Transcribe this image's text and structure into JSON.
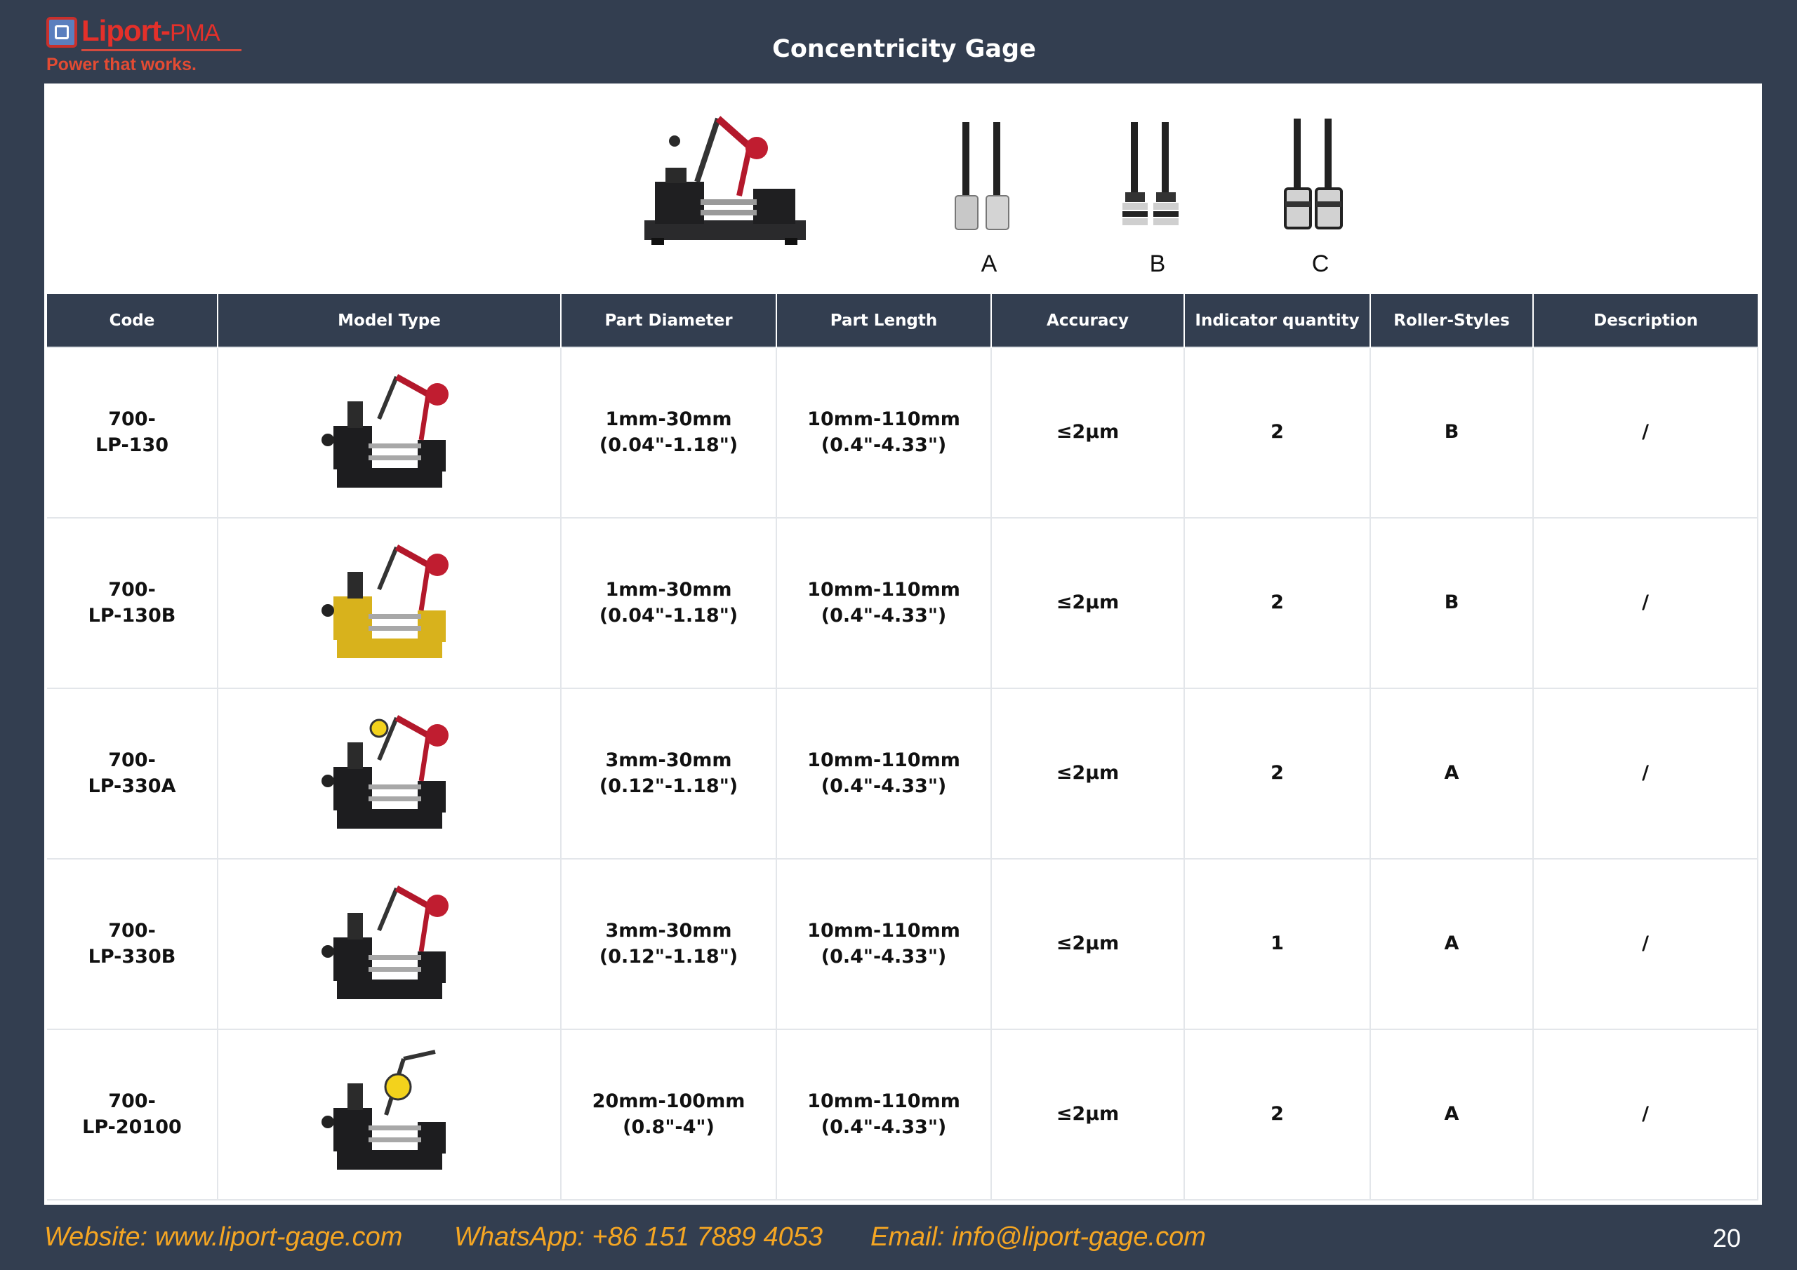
{
  "header": {
    "logo_name": "Liport-",
    "logo_suffix": "PMA",
    "logo_tagline": "Power that works.",
    "title": "Concentricity Gage"
  },
  "roller_styles": [
    "A",
    "B",
    "C"
  ],
  "table": {
    "columns": [
      "Code",
      "Model Type",
      "Part Diameter",
      "Part Length",
      "Accuracy",
      "Indicator quantity",
      "Roller-Styles",
      "Description"
    ],
    "rows": [
      {
        "code_line1": "700-",
        "code_line2": "LP-130",
        "gage_color": "#1d1d1f",
        "indicator": "red-arm",
        "diameter_line1": "1mm-30mm",
        "diameter_line2": "(0.04\"-1.18\")",
        "length_line1": "10mm-110mm",
        "length_line2": "(0.4\"-4.33\")",
        "accuracy": "≤2μm",
        "indicator_qty": "2",
        "roller": "B",
        "description": "/"
      },
      {
        "code_line1": "700-",
        "code_line2": "LP-130B",
        "gage_color": "#d8b21c",
        "indicator": "red-arm",
        "diameter_line1": "1mm-30mm",
        "diameter_line2": "(0.04\"-1.18\")",
        "length_line1": "10mm-110mm",
        "length_line2": "(0.4\"-4.33\")",
        "accuracy": "≤2μm",
        "indicator_qty": "2",
        "roller": "B",
        "description": "/"
      },
      {
        "code_line1": "700-",
        "code_line2": "LP-330A",
        "gage_color": "#1d1d1f",
        "indicator": "red-arm-dial",
        "diameter_line1": "3mm-30mm",
        "diameter_line2": "(0.12\"-1.18\")",
        "length_line1": "10mm-110mm",
        "length_line2": "(0.4\"-4.33\")",
        "accuracy": "≤2μm",
        "indicator_qty": "2",
        "roller": "A",
        "description": "/"
      },
      {
        "code_line1": "700-",
        "code_line2": "LP-330B",
        "gage_color": "#1d1d1f",
        "indicator": "red-arm",
        "diameter_line1": "3mm-30mm",
        "diameter_line2": "(0.12\"-1.18\")",
        "length_line1": "10mm-110mm",
        "length_line2": "(0.4\"-4.33\")",
        "accuracy": "≤2μm",
        "indicator_qty": "1",
        "roller": "A",
        "description": "/"
      },
      {
        "code_line1": "700-",
        "code_line2": "LP-20100",
        "gage_color": "#1d1d1f",
        "indicator": "yellow-dial",
        "diameter_line1": "20mm-100mm",
        "diameter_line2": "(0.8\"-4\")",
        "length_line1": "10mm-110mm",
        "length_line2": "(0.4\"-4.33\")",
        "accuracy": "≤2μm",
        "indicator_qty": "2",
        "roller": "A",
        "description": "/"
      }
    ]
  },
  "footer": {
    "website": "Website: www.liport-gage.com",
    "whatsapp": "WhatsApp: +86 151 7889 4053",
    "email": "Email: info@liport-gage.com",
    "page_number": "20"
  },
  "colors": {
    "background": "#333e50",
    "footer_text": "#f5a623",
    "brand_red": "#e4302a"
  }
}
